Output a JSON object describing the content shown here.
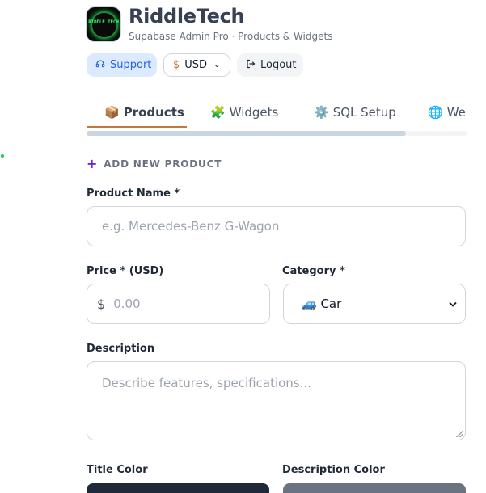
{
  "brand": {
    "name": "RiddleTech",
    "subtitle": "Supabase Admin Pro · Products & Widgets",
    "logo_text": "RIDDLE TECH"
  },
  "header_actions": {
    "support": {
      "label": "Support",
      "icon": "headset-icon"
    },
    "currency": {
      "symbol": "$",
      "value": "USD"
    },
    "logout": {
      "label": "Logout",
      "icon": "logout-icon"
    }
  },
  "tabs": [
    {
      "label": "Products",
      "icon": "📦",
      "active": true
    },
    {
      "label": "Widgets",
      "icon": "🧩",
      "active": false
    },
    {
      "label": "SQL Setup",
      "icon": "⚙️",
      "active": false
    },
    {
      "label": "Web",
      "icon": "🌐",
      "active": false
    }
  ],
  "tab_scroll_fraction": 0.84,
  "form": {
    "section_title": "ADD NEW PRODUCT",
    "product_name": {
      "label": "Product Name *",
      "placeholder": "e.g. Mercedes-Benz G-Wagon"
    },
    "price": {
      "label": "Price * (USD)",
      "prefix": "$",
      "placeholder": "0.00"
    },
    "category": {
      "label": "Category *",
      "value": "🚙 Car"
    },
    "description": {
      "label": "Description",
      "placeholder": "Describe features, specifications..."
    },
    "title_color": {
      "label": "Title Color",
      "value": "#1f2937"
    },
    "description_color": {
      "label": "Description Color",
      "value": "#6b7280"
    }
  },
  "colors": {
    "accent": "#c2773d",
    "support_bg": "#dbeafe",
    "support_text": "#2563eb",
    "plus": "#6d28d9"
  }
}
